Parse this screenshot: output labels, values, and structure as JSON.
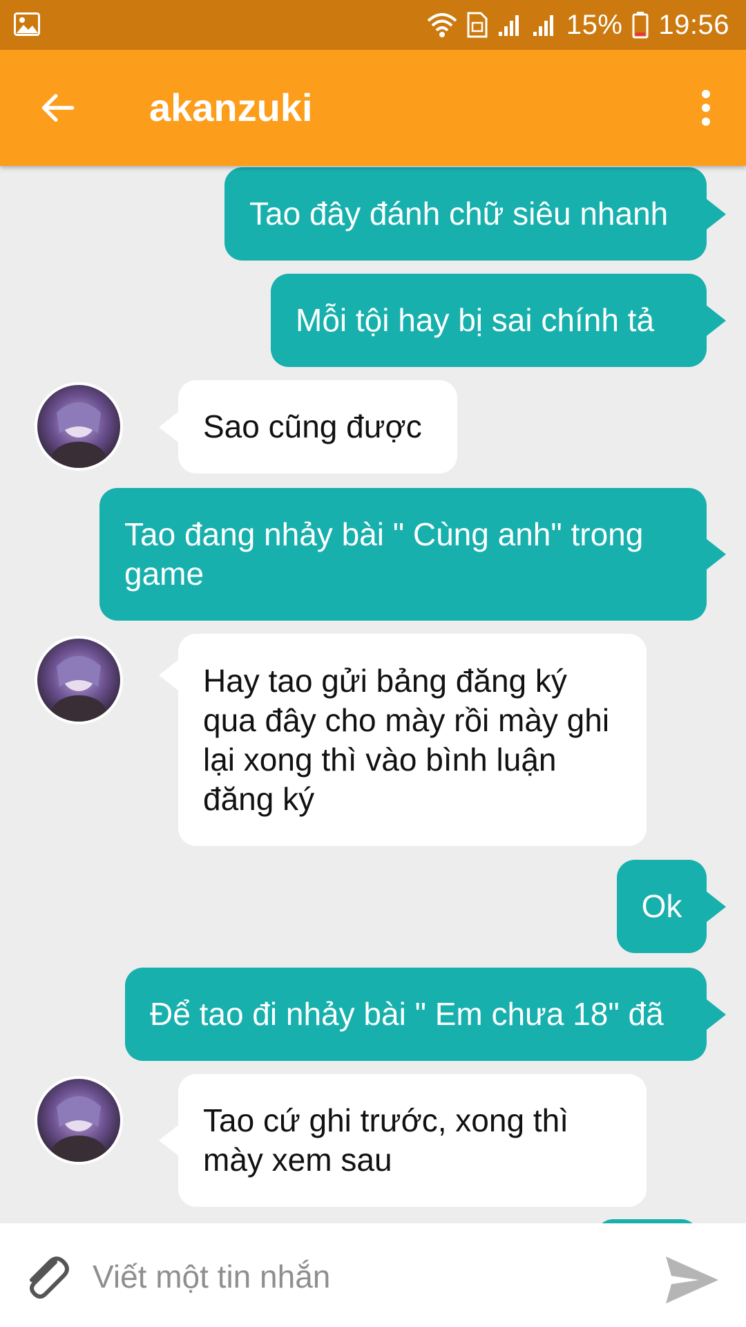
{
  "status_bar": {
    "battery": "15%",
    "time": "19:56",
    "icons": [
      "gallery-icon",
      "wifi-icon",
      "sim-icon",
      "signal-icon",
      "signal-icon",
      "battery-icon"
    ]
  },
  "header": {
    "title": "akanzuki",
    "back_icon": "arrow-left-icon",
    "menu_icon": "more-vertical-icon"
  },
  "messages": [
    {
      "from": "me",
      "text": "Tao đây đánh chữ siêu nhanh"
    },
    {
      "from": "me",
      "text": "Mỗi tội hay bị sai chính tả"
    },
    {
      "from": "them",
      "text": "Sao cũng được"
    },
    {
      "from": "me",
      "text": "Tao đang nhảy bài \" Cùng anh\" trong game"
    },
    {
      "from": "them",
      "text": "Hay tao gửi bảng đăng ký qua đây cho mày rồi mày ghi lại xong thì vào bình luận đăng ký"
    },
    {
      "from": "me",
      "text": "Ok"
    },
    {
      "from": "me",
      "text": "Để tao đi nhảy bài \" Em chưa 18\" đã"
    },
    {
      "from": "them",
      "text": "Tao cứ ghi trước, xong thì mày xem sau"
    }
  ],
  "composer": {
    "placeholder": "Viết một tin nhắn",
    "attach_icon": "paperclip-icon",
    "send_icon": "send-icon"
  },
  "colors": {
    "status_bar": "#cc7a10",
    "app_bar": "#fc9d1b",
    "outgoing_bubble": "#17b0ad",
    "incoming_bubble": "#ffffff",
    "background": "#ededed"
  }
}
